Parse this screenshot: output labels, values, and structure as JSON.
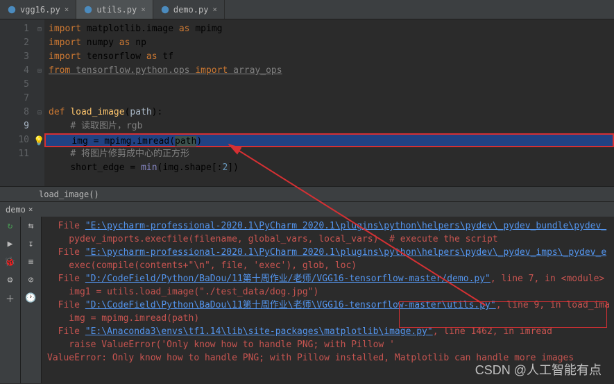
{
  "tabs": [
    {
      "name": "vgg16.py",
      "active": false
    },
    {
      "name": "utils.py",
      "active": true
    },
    {
      "name": "demo.py",
      "active": false
    }
  ],
  "gutter_lines": [
    "1",
    "2",
    "3",
    "4",
    "5",
    "",
    "7",
    "8",
    "9",
    "10",
    "11"
  ],
  "code": {
    "l1": {
      "kw1": "import ",
      "mod": "matplotlib.image ",
      "kw2": "as ",
      "alias": "mpimg"
    },
    "l2": {
      "kw1": "import ",
      "mod": "numpy ",
      "kw2": "as ",
      "alias": "np"
    },
    "l3": {
      "kw1": "import ",
      "mod": "tensorflow ",
      "kw2": "as ",
      "alias": "tf"
    },
    "l4": {
      "kw1": "from ",
      "mod": "tensorflow.python.ops ",
      "kw2": "import ",
      "name": "array_ops"
    },
    "l7": {
      "kw1": "def ",
      "fn": "load_image",
      "paren1": "(",
      "param": "path",
      "paren2": "):"
    },
    "l8": {
      "cmt": "# 读取图片，rgb"
    },
    "l9": {
      "var": "img = mpimg.imread(",
      "param": "path",
      "close": ")"
    },
    "l10": {
      "cmt": "# 将图片修剪成中心的正方形"
    },
    "l11": {
      "var": "short_edge = ",
      "fn": "min",
      "rest": "(img.shape[:",
      "num": "2",
      "close": "])"
    }
  },
  "breadcrumb": "load_image()",
  "console_tab": "demo",
  "console": {
    "l1_pre": "  File ",
    "l1_link": "\"E:\\pycharm-professional-2020.1\\PyCharm 2020.1\\plugins\\python\\helpers\\pydev\\_pydev_bundle\\pydev_",
    "l2": "    pydev_imports.execfile(filename, global_vars, local_vars)  # execute the script",
    "l3_pre": "  File ",
    "l3_link": "\"E:\\pycharm-professional-2020.1\\PyCharm 2020.1\\plugins\\python\\helpers\\pydev\\_pydev_imps\\_pydev_e",
    "l4": "    exec(compile(contents+\"\\n\", file, 'exec'), glob, loc)",
    "l5_pre": "  File ",
    "l5_link": "\"D:/CodeField/Python/BaDou/11第十周作业/老师/VGG16-tensorflow-master/demo.py\"",
    "l5_post": ", line 7, in <module>",
    "l6": "    img1 = utils.load_image(\"./test_data/dog.jpg\")",
    "l7_pre": "  File ",
    "l7_link": "\"D:\\CodeField\\Python\\BaDou\\11第十周作业\\老师\\VGG16-tensorflow-master\\utils.py\"",
    "l7_post": ", line 9, in load_ima",
    "l8": "    img = mpimg.imread(path)",
    "l9_pre": "  File ",
    "l9_link": "\"E:\\Anaconda3\\envs\\tf1.14\\lib\\site-packages\\matplotlib\\image.py\"",
    "l9_post": ", line 1462, in imread",
    "l10": "    raise ValueError('Only know how to handle PNG; with Pillow '",
    "l11": "ValueError: Only know how to handle PNG; with Pillow installed, Matplotlib can handle more images"
  },
  "watermark": "CSDN @人工智能有点"
}
